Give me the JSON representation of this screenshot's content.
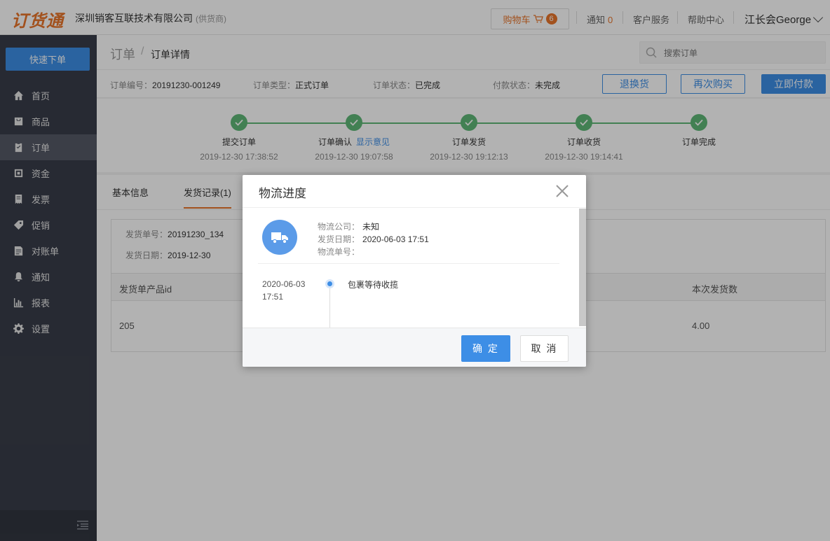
{
  "header": {
    "logo": "订货通",
    "company": "深圳销客互联技术有限公司",
    "company_tag": "(供货商)",
    "cart_label": "购物车",
    "cart_count": "6",
    "notify_label": "通知",
    "notify_count": "0",
    "service_label": "客户服务",
    "help_label": "帮助中心",
    "user_name": "江长会George"
  },
  "sidebar": {
    "quick_order": "快速下单",
    "items": [
      {
        "label": "首页",
        "icon": "home-icon"
      },
      {
        "label": "商品",
        "icon": "goods-icon"
      },
      {
        "label": "订单",
        "icon": "order-icon"
      },
      {
        "label": "资金",
        "icon": "fund-icon"
      },
      {
        "label": "发票",
        "icon": "invoice-icon"
      },
      {
        "label": "促销",
        "icon": "tag-icon"
      },
      {
        "label": "对账单",
        "icon": "statement-icon"
      },
      {
        "label": "通知",
        "icon": "bell-icon"
      },
      {
        "label": "报表",
        "icon": "chart-icon"
      },
      {
        "label": "设置",
        "icon": "gear-icon"
      }
    ],
    "active_index": 2
  },
  "breadcrumb": {
    "root": "订单",
    "separator": "/",
    "current": "订单详情"
  },
  "search": {
    "placeholder": "搜索订单"
  },
  "order_info": {
    "number_label": "订单编号：",
    "number": "20191230-001249",
    "type_label": "订单类型：",
    "type": "正式订单",
    "status_label": "订单状态：",
    "status": "已完成",
    "pay_label": "付款状态：",
    "pay": "未完成",
    "btn_return": "退换货",
    "btn_rebuy": "再次购买",
    "btn_pay": "立即付款"
  },
  "steps": [
    {
      "title": "提交订单",
      "time": "2019-12-30 17:38:52",
      "link": ""
    },
    {
      "title": "订单确认",
      "time": "2019-12-30 19:07:58",
      "link": "显示意见"
    },
    {
      "title": "订单发货",
      "time": "2019-12-30 19:12:13",
      "link": ""
    },
    {
      "title": "订单收货",
      "time": "2019-12-30 19:14:41",
      "link": ""
    },
    {
      "title": "订单完成",
      "time": "",
      "link": ""
    }
  ],
  "tabs": {
    "basic": "基本信息",
    "shipping": "发货记录(1)"
  },
  "shipment": {
    "no_label": "发货单号：",
    "no": "20191230_134",
    "date_label": "发货日期：",
    "date": "2019-12-30",
    "col_product_id": "发货单产品id",
    "col_qty": "本次发货数",
    "row_product_id": "205",
    "row_qty": "4.00"
  },
  "modal": {
    "title": "物流进度",
    "company_label": "物流公司：",
    "company": "未知",
    "date_label": "发货日期：",
    "date": "2020-06-03 17:51",
    "tracking_label": "物流单号：",
    "tracking": "",
    "timeline": [
      {
        "date": "2020-06-03",
        "time": "17:51",
        "text": "包裹等待收揽"
      }
    ],
    "ok": "确 定",
    "cancel": "取 消"
  },
  "colors": {
    "brand_orange": "#e8742a",
    "primary_blue": "#3d8ee6",
    "step_green": "#5fb878",
    "sidebar_bg": "#393d49"
  }
}
